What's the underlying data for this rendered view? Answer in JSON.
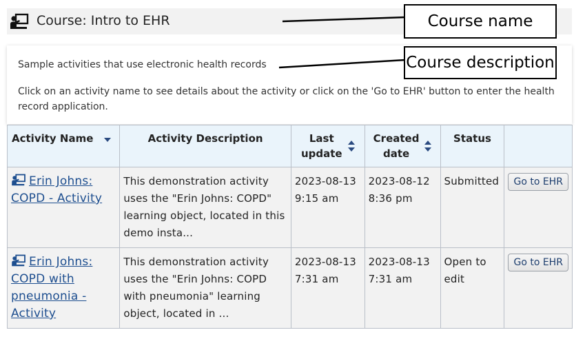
{
  "course": {
    "title": "Course: Intro to EHR",
    "description": "Sample activities that use electronic health records",
    "instructions": "Click on an activity name to see details about the activity or click on the 'Go to EHR' button to enter the health record application."
  },
  "callouts": {
    "course_name": "Course name",
    "course_description": "Course description"
  },
  "table": {
    "headers": {
      "activity_name": "Activity Name",
      "activity_description": "Activity Description",
      "last_update_1": "Last",
      "last_update_2": "update",
      "created_date_1": "Created",
      "created_date_2": "date",
      "status": "Status",
      "actions": ""
    },
    "rows": [
      {
        "name": "Erin Johns: COPD - Activity",
        "description": "This demonstration activity uses the \"Erin Johns: COPD\" learning object, located in this demo insta...",
        "last_update_date": "2023-08-13",
        "last_update_time": "9:15 am",
        "created_date": "2023-08-12",
        "created_time": "8:36 pm",
        "status": "Submitted",
        "button": "Go to EHR"
      },
      {
        "name": "Erin Johns: COPD with pneumonia - Activity",
        "description": "This demonstration activity uses the \"Erin Johns: COPD with pneumonia\" learning object, located in ...",
        "last_update_date": "2023-08-13",
        "last_update_time": "7:31 am",
        "created_date": "2023-08-13",
        "created_time": "7:31 am",
        "status": "Open to edit",
        "button": "Go to EHR"
      }
    ]
  },
  "icons": {
    "course": "course-presentation-icon",
    "activity": "activity-presentation-icon",
    "sort_desc": "sort-descending-icon",
    "sort_both": "sort-both-icon"
  },
  "colors": {
    "link": "#1d4e8f",
    "header_bg": "#eaf4fb",
    "row_bg": "#f2f2f2",
    "sort_icon": "#2a4a80"
  }
}
